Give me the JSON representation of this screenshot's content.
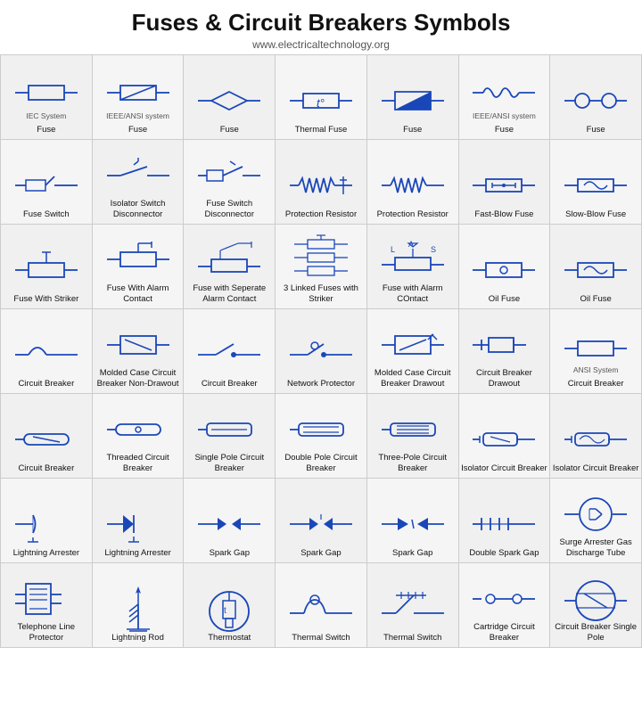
{
  "header": {
    "title": "Fuses & Circuit Breakers Symbols",
    "subtitle": "www.electricaltechnology.org"
  },
  "grid": {
    "rows": [
      [
        {
          "label": "Fuse",
          "sublabel": "IEC System"
        },
        {
          "label": "Fuse",
          "sublabel": "IEEE/ANSI system"
        },
        {
          "label": "Fuse",
          "sublabel": ""
        },
        {
          "label": "Thermal Fuse",
          "sublabel": ""
        },
        {
          "label": "Fuse",
          "sublabel": ""
        },
        {
          "label": "Fuse",
          "sublabel": "IEEE/ANSI system"
        },
        {
          "label": "Fuse",
          "sublabel": ""
        }
      ],
      [
        {
          "label": "Fuse Switch",
          "sublabel": ""
        },
        {
          "label": "Isolator Switch Disconnector",
          "sublabel": ""
        },
        {
          "label": "Fuse Switch Disconnector",
          "sublabel": ""
        },
        {
          "label": "Protection Resistor",
          "sublabel": ""
        },
        {
          "label": "Protection Resistor",
          "sublabel": ""
        },
        {
          "label": "Fast-Blow Fuse",
          "sublabel": ""
        },
        {
          "label": "Slow-Blow Fuse",
          "sublabel": ""
        }
      ],
      [
        {
          "label": "Fuse With Striker",
          "sublabel": ""
        },
        {
          "label": "Fuse With Alarm Contact",
          "sublabel": ""
        },
        {
          "label": "Fuse with Seperate Alarm Contact",
          "sublabel": ""
        },
        {
          "label": "3 Linked Fuses with Striker",
          "sublabel": ""
        },
        {
          "label": "Fuse with Alarm COntact",
          "sublabel": ""
        },
        {
          "label": "Oil Fuse",
          "sublabel": ""
        },
        {
          "label": "Oil Fuse",
          "sublabel": ""
        }
      ],
      [
        {
          "label": "Circuit Breaker",
          "sublabel": ""
        },
        {
          "label": "Molded Case Circuit Breaker Non-Drawout",
          "sublabel": ""
        },
        {
          "label": "Circuit Breaker",
          "sublabel": ""
        },
        {
          "label": "Network Protector",
          "sublabel": ""
        },
        {
          "label": "Molded Case Circuit Breaker Drawout",
          "sublabel": ""
        },
        {
          "label": "Circuit Breaker Drawout",
          "sublabel": ""
        },
        {
          "label": "Circuit Breaker",
          "sublabel": "ANSI System"
        }
      ],
      [
        {
          "label": "Circuit Breaker",
          "sublabel": ""
        },
        {
          "label": "Threaded Circuit Breaker",
          "sublabel": ""
        },
        {
          "label": "Single Pole Circuit Breaker",
          "sublabel": ""
        },
        {
          "label": "Double Pole Circuit Breaker",
          "sublabel": ""
        },
        {
          "label": "Three-Pole Circuit Breaker",
          "sublabel": ""
        },
        {
          "label": "Isolator Circuit Breaker",
          "sublabel": ""
        },
        {
          "label": "Isolator Circuit Breaker",
          "sublabel": ""
        }
      ],
      [
        {
          "label": "Lightning Arrester",
          "sublabel": ""
        },
        {
          "label": "Lightning Arrester",
          "sublabel": ""
        },
        {
          "label": "Spark Gap",
          "sublabel": ""
        },
        {
          "label": "Spark Gap",
          "sublabel": ""
        },
        {
          "label": "Spark Gap",
          "sublabel": ""
        },
        {
          "label": "Double Spark Gap",
          "sublabel": ""
        },
        {
          "label": "Surge Arrester Gas Discharge Tube",
          "sublabel": ""
        }
      ],
      [
        {
          "label": "Telephone Line Protector",
          "sublabel": ""
        },
        {
          "label": "Lightning Rod",
          "sublabel": ""
        },
        {
          "label": "Thermostat",
          "sublabel": ""
        },
        {
          "label": "Thermal Switch",
          "sublabel": ""
        },
        {
          "label": "Thermal Switch",
          "sublabel": ""
        },
        {
          "label": "Cartridge Circuit Breaker",
          "sublabel": ""
        },
        {
          "label": "Circuit Breaker Single Pole",
          "sublabel": ""
        }
      ]
    ]
  }
}
